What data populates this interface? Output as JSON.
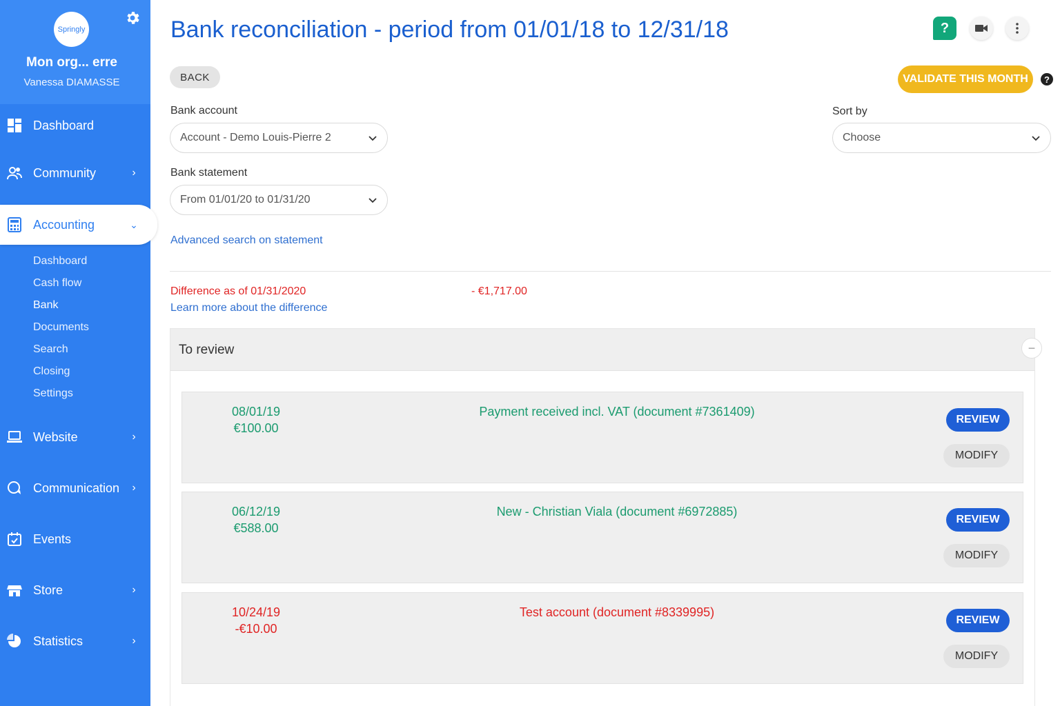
{
  "sidebar": {
    "logo_text": "Springly",
    "org_name": "Mon org... erre",
    "user_name": "Vanessa DIAMASSE",
    "items": {
      "dashboard": "Dashboard",
      "community": "Community",
      "accounting": "Accounting",
      "website": "Website",
      "communication": "Communication",
      "events": "Events",
      "store": "Store",
      "statistics": "Statistics"
    },
    "accounting_sub": [
      "Dashboard",
      "Cash flow",
      "Bank",
      "Documents",
      "Search",
      "Closing",
      "Settings"
    ],
    "current_sub": "Bank"
  },
  "header": {
    "title": "Bank reconciliation - period from 01/01/18 to 12/31/18",
    "back_label": "BACK",
    "validate_label": "VALIDATE THIS MONTH",
    "help_glyph": "?"
  },
  "filters": {
    "bank_account_label": "Bank account",
    "bank_account_value": "Account - Demo Louis-Pierre 2",
    "bank_statement_label": "Bank statement",
    "bank_statement_value": "From 01/01/20 to 01/31/20",
    "sort_by_label": "Sort by",
    "sort_by_value": "Choose",
    "advanced_search_link": "Advanced search on statement"
  },
  "difference": {
    "label": "Difference as of 01/31/2020",
    "value": "- €1,717.00",
    "learn_more": "Learn more about the difference"
  },
  "review": {
    "title": "To review",
    "review_label": "REVIEW",
    "modify_label": "MODIFY",
    "transactions": [
      {
        "date": "08/01/19",
        "amount": "€100.00",
        "description": "Payment received incl. VAT (document #7361409)",
        "status": "positive"
      },
      {
        "date": "06/12/19",
        "amount": "€588.00",
        "description": "New - Christian Viala (document #6972885)",
        "status": "positive"
      },
      {
        "date": "10/24/19",
        "amount": "-€10.00",
        "description": "Test account  (document #8339995)",
        "status": "negative"
      }
    ]
  },
  "colors": {
    "sidebar": "#2f7ff0",
    "title": "#1a5fcf",
    "validate": "#f0b81e",
    "positive": "#1b9b6f",
    "negative": "#e02424",
    "review_button": "#1f5fd6"
  },
  "icons": [
    "settings-gear-icon",
    "dashboard-icon",
    "community-icon",
    "accounting-calculator-icon",
    "website-laptop-icon",
    "communication-chat-icon",
    "events-calendar-icon",
    "store-icon",
    "statistics-pie-icon",
    "help-icon",
    "video-camera-icon",
    "more-vertical-icon",
    "chevron-down-icon",
    "collapse-minus-icon"
  ]
}
